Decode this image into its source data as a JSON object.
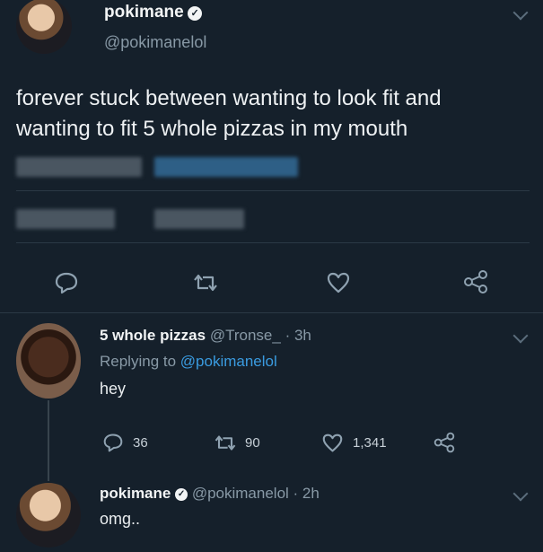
{
  "tweet": {
    "author_name": "pokimane",
    "author_handle": "@pokimanelol",
    "text_line1": "forever stuck between wanting to look fit and",
    "text_line2": "wanting to fit 5 whole pizzas in my mouth"
  },
  "reply1": {
    "author_name": "5 whole pizzas",
    "author_handle": "@Tronse_",
    "time": "· 3h",
    "replying_prefix": "Replying to",
    "replying_handle": "@pokimanelol",
    "text": "hey",
    "replies": "36",
    "retweets": "90",
    "likes": "1,341"
  },
  "reply2": {
    "author_name": "pokimane",
    "author_handle": "@pokimanelol",
    "time": "· 2h",
    "text": "omg.."
  },
  "icons": [
    "reply-icon",
    "retweet-icon",
    "like-icon",
    "share-icon",
    "chevron-down-icon",
    "verified-icon"
  ],
  "colors": {
    "background": "#15202b",
    "text": "#e9edef",
    "muted": "#8899a6",
    "link": "#3a9be0",
    "divider": "#2b3945"
  }
}
